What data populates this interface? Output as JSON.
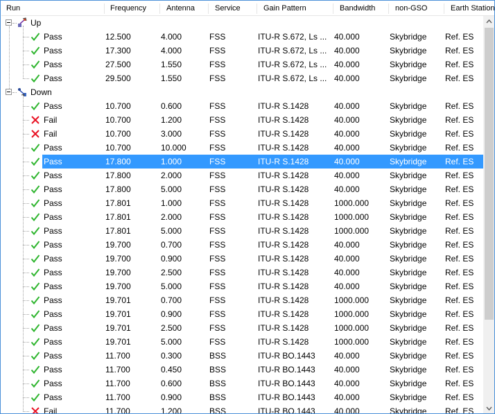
{
  "columns": [
    {
      "key": "run",
      "label": "Run"
    },
    {
      "key": "frequency",
      "label": "Frequency"
    },
    {
      "key": "antenna",
      "label": "Antenna"
    },
    {
      "key": "service",
      "label": "Service"
    },
    {
      "key": "gain_pattern",
      "label": "Gain Pattern"
    },
    {
      "key": "bandwidth",
      "label": "Bandwidth"
    },
    {
      "key": "non_gso",
      "label": "non-GSO"
    },
    {
      "key": "earth_station",
      "label": "Earth Station"
    }
  ],
  "groups": [
    {
      "label": "Up",
      "icon": "uplink-satellite-icon",
      "expanded": true,
      "rows": [
        {
          "status": "Pass",
          "frequency": "12.500",
          "antenna": "4.000",
          "service": "FSS",
          "gain_pattern": "ITU-R S.672, Ls ...",
          "bandwidth": "40.000",
          "non_gso": "Skybridge",
          "earth_station": "Ref. ES"
        },
        {
          "status": "Pass",
          "frequency": "17.300",
          "antenna": "4.000",
          "service": "FSS",
          "gain_pattern": "ITU-R S.672, Ls ...",
          "bandwidth": "40.000",
          "non_gso": "Skybridge",
          "earth_station": "Ref. ES"
        },
        {
          "status": "Pass",
          "frequency": "27.500",
          "antenna": "1.550",
          "service": "FSS",
          "gain_pattern": "ITU-R S.672, Ls ...",
          "bandwidth": "40.000",
          "non_gso": "Skybridge",
          "earth_station": "Ref. ES"
        },
        {
          "status": "Pass",
          "frequency": "29.500",
          "antenna": "1.550",
          "service": "FSS",
          "gain_pattern": "ITU-R S.672, Ls ...",
          "bandwidth": "40.000",
          "non_gso": "Skybridge",
          "earth_station": "Ref. ES"
        }
      ]
    },
    {
      "label": "Down",
      "icon": "downlink-satellite-icon",
      "expanded": true,
      "rows": [
        {
          "status": "Pass",
          "frequency": "10.700",
          "antenna": "0.600",
          "service": "FSS",
          "gain_pattern": "ITU-R S.1428",
          "bandwidth": "40.000",
          "non_gso": "Skybridge",
          "earth_station": "Ref. ES"
        },
        {
          "status": "Fail",
          "frequency": "10.700",
          "antenna": "1.200",
          "service": "FSS",
          "gain_pattern": "ITU-R S.1428",
          "bandwidth": "40.000",
          "non_gso": "Skybridge",
          "earth_station": "Ref. ES"
        },
        {
          "status": "Fail",
          "frequency": "10.700",
          "antenna": "3.000",
          "service": "FSS",
          "gain_pattern": "ITU-R S.1428",
          "bandwidth": "40.000",
          "non_gso": "Skybridge",
          "earth_station": "Ref. ES"
        },
        {
          "status": "Pass",
          "frequency": "10.700",
          "antenna": "10.000",
          "service": "FSS",
          "gain_pattern": "ITU-R S.1428",
          "bandwidth": "40.000",
          "non_gso": "Skybridge",
          "earth_station": "Ref. ES"
        },
        {
          "status": "Pass",
          "frequency": "17.800",
          "antenna": "1.000",
          "service": "FSS",
          "gain_pattern": "ITU-R S.1428",
          "bandwidth": "40.000",
          "non_gso": "Skybridge",
          "earth_station": "Ref. ES",
          "selected": true
        },
        {
          "status": "Pass",
          "frequency": "17.800",
          "antenna": "2.000",
          "service": "FSS",
          "gain_pattern": "ITU-R S.1428",
          "bandwidth": "40.000",
          "non_gso": "Skybridge",
          "earth_station": "Ref. ES"
        },
        {
          "status": "Pass",
          "frequency": "17.800",
          "antenna": "5.000",
          "service": "FSS",
          "gain_pattern": "ITU-R S.1428",
          "bandwidth": "40.000",
          "non_gso": "Skybridge",
          "earth_station": "Ref. ES"
        },
        {
          "status": "Pass",
          "frequency": "17.801",
          "antenna": "1.000",
          "service": "FSS",
          "gain_pattern": "ITU-R S.1428",
          "bandwidth": "1000.000",
          "non_gso": "Skybridge",
          "earth_station": "Ref. ES"
        },
        {
          "status": "Pass",
          "frequency": "17.801",
          "antenna": "2.000",
          "service": "FSS",
          "gain_pattern": "ITU-R S.1428",
          "bandwidth": "1000.000",
          "non_gso": "Skybridge",
          "earth_station": "Ref. ES"
        },
        {
          "status": "Pass",
          "frequency": "17.801",
          "antenna": "5.000",
          "service": "FSS",
          "gain_pattern": "ITU-R S.1428",
          "bandwidth": "1000.000",
          "non_gso": "Skybridge",
          "earth_station": "Ref. ES"
        },
        {
          "status": "Pass",
          "frequency": "19.700",
          "antenna": "0.700",
          "service": "FSS",
          "gain_pattern": "ITU-R S.1428",
          "bandwidth": "40.000",
          "non_gso": "Skybridge",
          "earth_station": "Ref. ES"
        },
        {
          "status": "Pass",
          "frequency": "19.700",
          "antenna": "0.900",
          "service": "FSS",
          "gain_pattern": "ITU-R S.1428",
          "bandwidth": "40.000",
          "non_gso": "Skybridge",
          "earth_station": "Ref. ES"
        },
        {
          "status": "Pass",
          "frequency": "19.700",
          "antenna": "2.500",
          "service": "FSS",
          "gain_pattern": "ITU-R S.1428",
          "bandwidth": "40.000",
          "non_gso": "Skybridge",
          "earth_station": "Ref. ES"
        },
        {
          "status": "Pass",
          "frequency": "19.700",
          "antenna": "5.000",
          "service": "FSS",
          "gain_pattern": "ITU-R S.1428",
          "bandwidth": "40.000",
          "non_gso": "Skybridge",
          "earth_station": "Ref. ES"
        },
        {
          "status": "Pass",
          "frequency": "19.701",
          "antenna": "0.700",
          "service": "FSS",
          "gain_pattern": "ITU-R S.1428",
          "bandwidth": "1000.000",
          "non_gso": "Skybridge",
          "earth_station": "Ref. ES"
        },
        {
          "status": "Pass",
          "frequency": "19.701",
          "antenna": "0.900",
          "service": "FSS",
          "gain_pattern": "ITU-R S.1428",
          "bandwidth": "1000.000",
          "non_gso": "Skybridge",
          "earth_station": "Ref. ES"
        },
        {
          "status": "Pass",
          "frequency": "19.701",
          "antenna": "2.500",
          "service": "FSS",
          "gain_pattern": "ITU-R S.1428",
          "bandwidth": "1000.000",
          "non_gso": "Skybridge",
          "earth_station": "Ref. ES"
        },
        {
          "status": "Pass",
          "frequency": "19.701",
          "antenna": "5.000",
          "service": "FSS",
          "gain_pattern": "ITU-R S.1428",
          "bandwidth": "1000.000",
          "non_gso": "Skybridge",
          "earth_station": "Ref. ES"
        },
        {
          "status": "Pass",
          "frequency": "11.700",
          "antenna": "0.300",
          "service": "BSS",
          "gain_pattern": "ITU-R BO.1443",
          "bandwidth": "40.000",
          "non_gso": "Skybridge",
          "earth_station": "Ref. ES"
        },
        {
          "status": "Pass",
          "frequency": "11.700",
          "antenna": "0.450",
          "service": "BSS",
          "gain_pattern": "ITU-R BO.1443",
          "bandwidth": "40.000",
          "non_gso": "Skybridge",
          "earth_station": "Ref. ES"
        },
        {
          "status": "Pass",
          "frequency": "11.700",
          "antenna": "0.600",
          "service": "BSS",
          "gain_pattern": "ITU-R BO.1443",
          "bandwidth": "40.000",
          "non_gso": "Skybridge",
          "earth_station": "Ref. ES"
        },
        {
          "status": "Pass",
          "frequency": "11.700",
          "antenna": "0.900",
          "service": "BSS",
          "gain_pattern": "ITU-R BO.1443",
          "bandwidth": "40.000",
          "non_gso": "Skybridge",
          "earth_station": "Ref. ES"
        },
        {
          "status": "Fail",
          "frequency": "11.700",
          "antenna": "1.200",
          "service": "BSS",
          "gain_pattern": "ITU-R BO.1443",
          "bandwidth": "40.000",
          "non_gso": "Skybridge",
          "earth_station": "Ref. ES"
        }
      ]
    }
  ],
  "icons": {
    "pass": "check-mark-icon",
    "fail": "cross-mark-icon",
    "expander": "collapse-minus-icon",
    "scroll_up": "scroll-up-arrow-icon",
    "scroll_down": "scroll-down-arrow-icon"
  },
  "colors": {
    "pass": "#2fb52f",
    "fail": "#e81123",
    "selection": "#3399ff",
    "border": "#4a90d9"
  },
  "scrollbar": {
    "thumb_fraction": 0.78,
    "position_fraction": 0
  }
}
